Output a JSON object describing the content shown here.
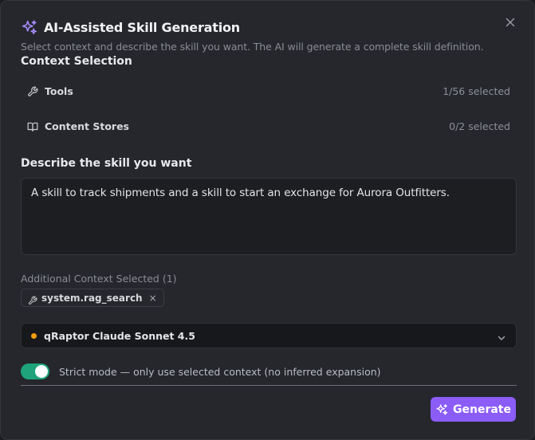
{
  "dialog": {
    "title": "AI-Assisted Skill Generation",
    "subtitle": "Select context and describe the skill you want. The AI will generate a complete skill definition."
  },
  "context": {
    "title": "Context Selection",
    "rows": [
      {
        "icon": "wrench-icon",
        "label": "Tools",
        "count": "1/56 selected"
      },
      {
        "icon": "book-icon",
        "label": "Content Stores",
        "count": "0/2 selected"
      }
    ]
  },
  "describe": {
    "title": "Describe the skill you want",
    "value": "A skill to track shipments and a skill to start an exchange for Aurora Outfitters."
  },
  "additional": {
    "label": "Additional Context Selected (1)",
    "chips": [
      {
        "icon": "wrench-icon",
        "text": "system.rag_search",
        "remove": "×"
      }
    ]
  },
  "model": {
    "value": "qRaptor Claude Sonnet 4.5",
    "status_color": "#f59e0b"
  },
  "strict": {
    "label": "Strict mode — only use selected context (no inferred expansion)",
    "enabled": true
  },
  "actions": {
    "generate_label": "Generate"
  },
  "colors": {
    "accent": "#8b5cf6",
    "toggle_on": "#1fa37a"
  }
}
